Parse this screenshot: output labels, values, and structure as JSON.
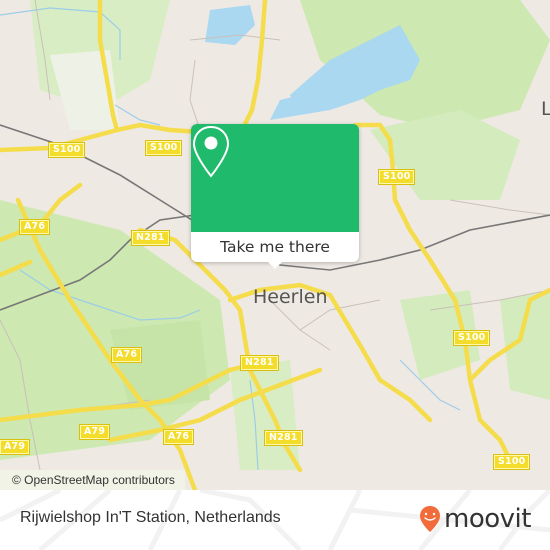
{
  "map": {
    "city_label": "Heerlen",
    "partial_city_label": "La",
    "attribution": "© OpenStreetMap contributors",
    "road_shields": [
      {
        "ref": "S100",
        "id": "s100-nw-1"
      },
      {
        "ref": "S100",
        "id": "s100-nw-2"
      },
      {
        "ref": "S100",
        "id": "s100-ne"
      },
      {
        "ref": "S100",
        "id": "s100-e"
      },
      {
        "ref": "S100",
        "id": "s100-se"
      },
      {
        "ref": "A76",
        "id": "a76-nw"
      },
      {
        "ref": "A76",
        "id": "a76-mid"
      },
      {
        "ref": "A76",
        "id": "a76-s"
      },
      {
        "ref": "N281",
        "id": "n281-w"
      },
      {
        "ref": "N281",
        "id": "n281-mid"
      },
      {
        "ref": "N281",
        "id": "n281-s"
      },
      {
        "ref": "A79",
        "id": "a79-mid"
      },
      {
        "ref": "A79",
        "id": "a79-w"
      }
    ],
    "colors": {
      "land": "#efe9e4",
      "green": "#cde8b0",
      "water": "#a9d8f0",
      "major_road": "#f5dc4a"
    }
  },
  "popup": {
    "icon": "map-pin-icon",
    "button_label": "Take me there",
    "accent_color": "#1fba6b"
  },
  "footer": {
    "place_name": "Rijwielshop In'T Station, Netherlands",
    "brand": "moovit",
    "brand_color": "#f26b3a"
  }
}
